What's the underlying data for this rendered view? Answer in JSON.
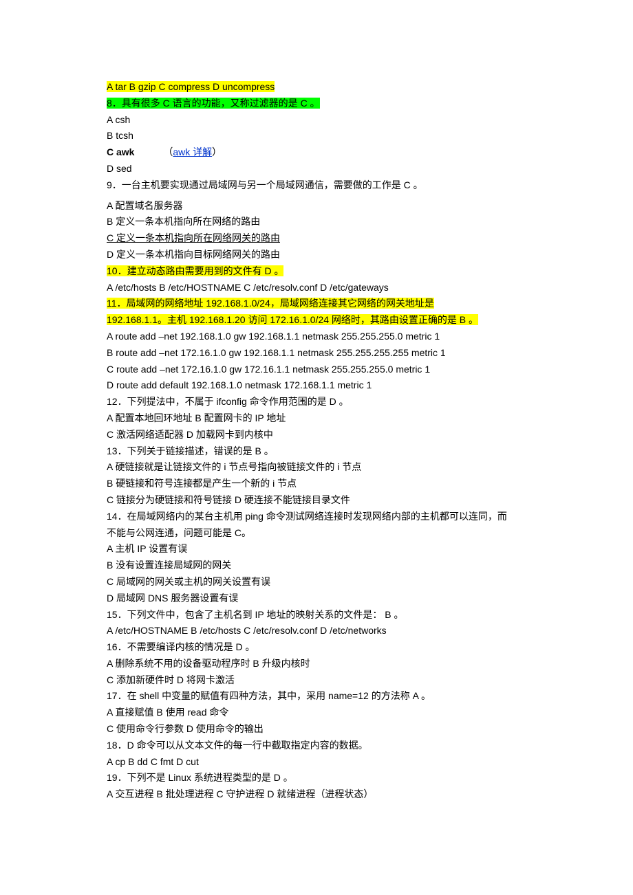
{
  "lines": {
    "l1": "A tar B gzip C compress D uncompress",
    "l2": "8．具有很多 C 语言的功能，又称过滤器的是  C 。",
    "l3a": "A csh",
    "l3b": "B tcsh",
    "l3c_bold": "C awk",
    "l3c_paren_open": "（",
    "l3c_link": "awk 详解",
    "l3c_paren_close": "）",
    "l3d": "D sed",
    "l4": "9．一台主机要实现通过局域网与另一个局域网通信，需要做的工作是  C 。",
    "l5a": "A  配置域名服务器",
    "l5b": "B  定义一条本机指向所在网络的路由",
    "l5c": "C  定义一条本机指向所在网络网关的路由",
    "l5d": "D  定义一条本机指向目标网络网关的路由",
    "l6": "10．建立动态路由需要用到的文件有  D 。",
    "l7": "A /etc/hosts B /etc/HOSTNAME C /etc/resolv.conf D /etc/gateways",
    "l8a": "11．局域网的网络地址 192.168.1.0/24，局域网络连接其它网络的网关地址是",
    "l8b": "192.168.1.1。主机 192.168.1.20 访问 172.16.1.0/24 网络时，其路由设置正确的是  B 。",
    "l9a": "A route add –net 192.168.1.0 gw 192.168.1.1 netmask 255.255.255.0 metric 1",
    "l9b": "B route add –net 172.16.1.0 gw 192.168.1.1 netmask 255.255.255.255 metric 1",
    "l9c": "C route add –net 172.16.1.0 gw 172.16.1.1 netmask 255.255.255.0 metric 1",
    "l9d": "D route add default 192.168.1.0 netmask 172.168.1.1 metric 1",
    "l10": "12．下列提法中，不属于 ifconfig 命令作用范围的是  D 。",
    "l11a": "A  配置本地回环地址  B  配置网卡的 IP 地址",
    "l11b": "C  激活网络适配器  D  加载网卡到内核中",
    "l12": "13．下列关于链接描述，错误的是  B 。",
    "l13a": "A  硬链接就是让链接文件的 i 节点号指向被链接文件的 i 节点",
    "l13b": "B  硬链接和符号连接都是产生一个新的 i 节点",
    "l13c": "C  链接分为硬链接和符号链接  D  硬连接不能链接目录文件",
    "l14a": "14．在局域网络内的某台主机用 ping 命令测试网络连接时发现网络内部的主机都可以连同，而",
    "l14b": "不能与公网连通，问题可能是  C。",
    "l15a": "A  主机 IP 设置有误",
    "l15b": "B  没有设置连接局域网的网关",
    "l15c": "C  局域网的网关或主机的网关设置有误",
    "l15d": "D  局域网 DNS 服务器设置有误",
    "l16": "15．下列文件中，包含了主机名到 IP 地址的映射关系的文件是：  B 。",
    "l17": "A /etc/HOSTNAME B /etc/hosts C /etc/resolv.conf D /etc/networks",
    "l18": "16．不需要编译内核的情况是  D 。",
    "l19a": "A  删除系统不用的设备驱动程序时  B  升级内核时",
    "l19b": "C  添加新硬件时  D  将网卡激活",
    "l20": "17．在 shell 中变量的赋值有四种方法，其中，采用 name=12 的方法称  A 。",
    "l21a": "A  直接赋值  B  使用 read 命令",
    "l21b": "C  使用命令行参数  D  使用命令的输出",
    "l22": "18．D  命令可以从文本文件的每一行中截取指定内容的数据。",
    "l23": "A cp B dd C fmt D cut",
    "l24": "19．下列不是 Linux 系统进程类型的是  D 。",
    "l25": "A  交互进程  B  批处理进程  C  守护进程  D  就绪进程（进程状态）"
  }
}
